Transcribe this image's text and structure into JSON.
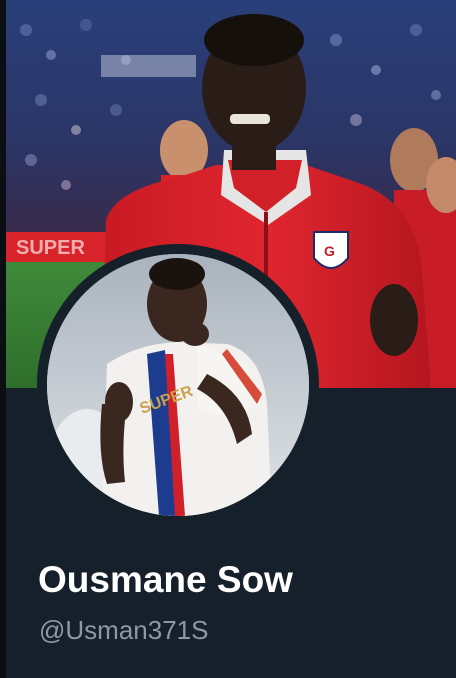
{
  "profile": {
    "display_name": "Ousmane Sow",
    "handle": "@Usman371S"
  },
  "banner": {
    "stadium_board_text": "SUPER"
  },
  "colors": {
    "background": "#15202b",
    "name_text": "#ffffff",
    "handle_text": "#8b98a5",
    "jacket_red": "#d8202b"
  }
}
